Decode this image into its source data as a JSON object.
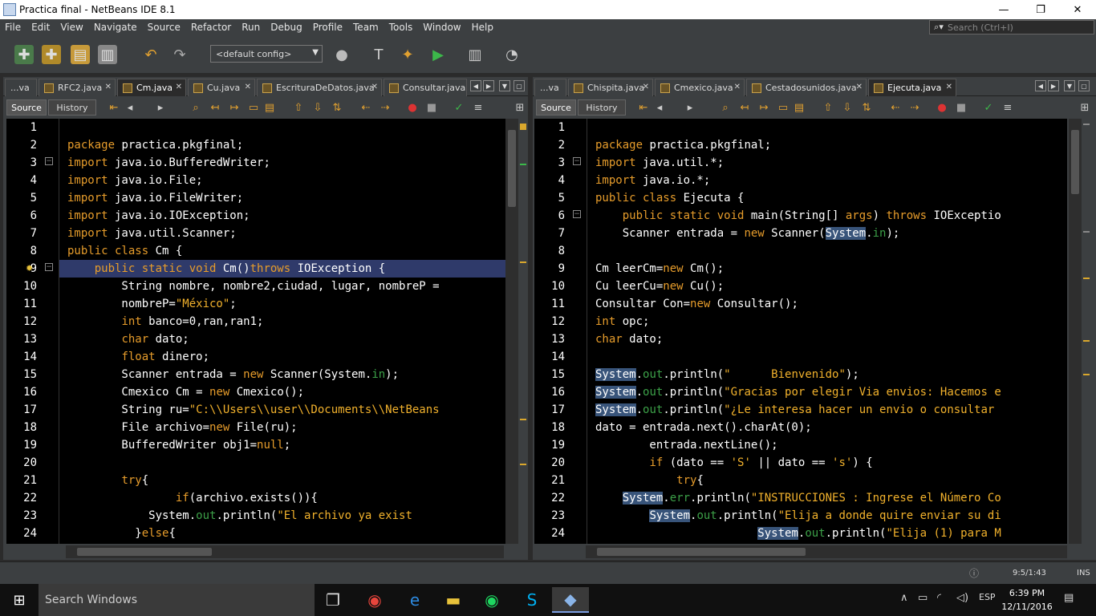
{
  "window": {
    "title": "Practica final - NetBeans IDE 8.1",
    "minimize": "—",
    "maximize": "❐",
    "close": "✕"
  },
  "menu": [
    "File",
    "Edit",
    "View",
    "Navigate",
    "Source",
    "Refactor",
    "Run",
    "Debug",
    "Profile",
    "Team",
    "Tools",
    "Window",
    "Help"
  ],
  "search": {
    "placeholder": "Search (Ctrl+I)"
  },
  "config": {
    "value": "<default config>"
  },
  "left": {
    "tabs": [
      "...va",
      "RFC2.java",
      "Cm.java",
      "Cu.java",
      "EscrituraDeDatos.java",
      "Consultar.java.."
    ],
    "active_tab": 2,
    "source_label": "Source",
    "history_label": "History",
    "lines": [
      "",
      "package practica.pkgfinal;",
      "import java.io.BufferedWriter;",
      "import java.io.File;",
      "import java.io.FileWriter;",
      "import java.io.IOException;",
      "import java.util.Scanner;",
      "public class Cm {",
      "public static void Cm()throws IOException {",
      "String nombre, nombre2,ciudad, lugar, nombreP =",
      "nombreP=\"México\";",
      "int banco=0,ran,ran1;",
      "char dato;",
      "float dinero;",
      "Scanner entrada = new Scanner(System.in);",
      "Cmexico Cm = new Cmexico();",
      "String ru=\"C:\\\\Users\\\\user\\\\Documents\\\\NetBeans",
      "File archivo=new File(ru);",
      "BufferedWriter obj1=null;",
      "",
      "try{",
      "if(archivo.exists()){",
      "System.out.println(\"El archivo ya exist",
      "}else{"
    ]
  },
  "right": {
    "tabs": [
      "...va",
      "Chispita.java",
      "Cmexico.java",
      "Cestadosunidos.java",
      "Ejecuta.java"
    ],
    "active_tab": 4,
    "source_label": "Source",
    "history_label": "History",
    "lines": [
      "",
      "package practica.pkgfinal;",
      "import java.util.*;",
      "import java.io.*;",
      "public class Ejecuta {",
      "public static void main(String[] args) throws IOExceptio",
      "Scanner entrada = new Scanner(System.in);",
      "",
      "Cm leerCm=new Cm();",
      "Cu leerCu=new Cu();",
      "Consultar Con=new Consultar();",
      "int opc;",
      "char dato;",
      "",
      "System.out.println(\"      Bienvenido\");",
      "System.out.println(\"Gracias por elegir Via envios: Hacemos e",
      "System.out.println(\"¿Le interesa hacer un envio o consultar",
      "dato = entrada.next().charAt(0);",
      "entrada.nextLine();",
      "if (dato == 'S' || dato == 's') {",
      "try{",
      "System.err.println(\"INSTRUCCIONES : Ingrese el Número Co",
      "System.out.println(\"Elija a donde quire enviar su di",
      "System.out.println(\"Elija (1) para M"
    ]
  },
  "status": {
    "position": "9:5/1:43",
    "mode": "INS"
  },
  "taskbar": {
    "search": "Search Windows",
    "lang": "ESP",
    "time": "6:39 PM",
    "date": "12/11/2016"
  }
}
